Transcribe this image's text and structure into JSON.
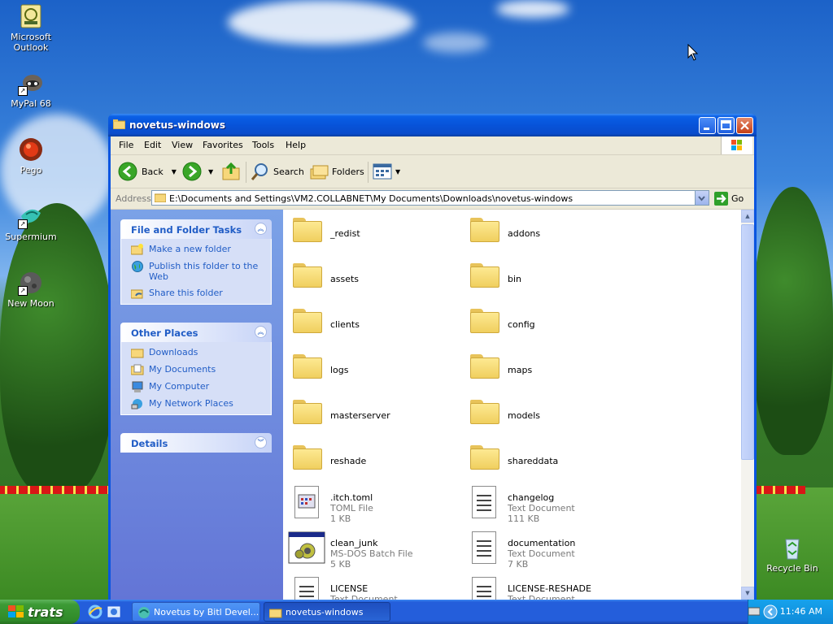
{
  "desktop": {
    "icons": [
      {
        "name": "microsoft-outlook",
        "label": "Microsoft Outlook"
      },
      {
        "name": "mypal-68",
        "label": "MyPal 68"
      },
      {
        "name": "pego",
        "label": "Pego"
      },
      {
        "name": "supermium",
        "label": "Supermium"
      },
      {
        "name": "new-moon",
        "label": "New Moon"
      },
      {
        "name": "recycle-bin",
        "label": "Recycle Bin"
      }
    ]
  },
  "window": {
    "title": "novetus-windows",
    "menu": [
      "File",
      "Edit",
      "View",
      "Favorites",
      "Tools",
      "Help"
    ],
    "toolbar": {
      "back": "Back",
      "search": "Search",
      "folders": "Folders"
    },
    "address": {
      "label": "Address",
      "path": "E:\\Documents and Settings\\VM2.COLLABNET\\My Documents\\Downloads\\novetus-windows",
      "go": "Go"
    }
  },
  "tasks": {
    "file_folder": {
      "title": "File and Folder Tasks",
      "items": [
        "Make a new folder",
        "Publish this folder to the Web",
        "Share this folder"
      ]
    },
    "other_places": {
      "title": "Other Places",
      "items": [
        "Downloads",
        "My Documents",
        "My Computer",
        "My Network Places"
      ]
    },
    "details": {
      "title": "Details"
    }
  },
  "files": [
    {
      "name": "_redist",
      "kind": "folder"
    },
    {
      "name": "addons",
      "kind": "folder"
    },
    {
      "name": "assets",
      "kind": "folder"
    },
    {
      "name": "bin",
      "kind": "folder"
    },
    {
      "name": "clients",
      "kind": "folder"
    },
    {
      "name": "config",
      "kind": "folder"
    },
    {
      "name": "logs",
      "kind": "folder"
    },
    {
      "name": "maps",
      "kind": "folder"
    },
    {
      "name": "masterserver",
      "kind": "folder"
    },
    {
      "name": "models",
      "kind": "folder"
    },
    {
      "name": "reshade",
      "kind": "folder"
    },
    {
      "name": "shareddata",
      "kind": "folder"
    },
    {
      "name": ".itch.toml",
      "kind": "toml",
      "type": "TOML File",
      "size": "1 KB"
    },
    {
      "name": "changelog",
      "kind": "text",
      "type": "Text Document",
      "size": "111 KB"
    },
    {
      "name": "clean_junk",
      "kind": "batch",
      "type": "MS-DOS Batch File",
      "size": "5 KB"
    },
    {
      "name": "documentation",
      "kind": "text",
      "type": "Text Document",
      "size": "7 KB"
    },
    {
      "name": "LICENSE",
      "kind": "text",
      "type": "Text Document",
      "size": ""
    },
    {
      "name": "LICENSE-RESHADE",
      "kind": "text",
      "type": "Text Document",
      "size": ""
    }
  ],
  "taskbar": {
    "start": "trats",
    "tasks": [
      {
        "label": "Novetus by Bitl Devel...",
        "active": false
      },
      {
        "label": "novetus-windows",
        "active": true
      }
    ],
    "clock": "11:46 AM"
  }
}
